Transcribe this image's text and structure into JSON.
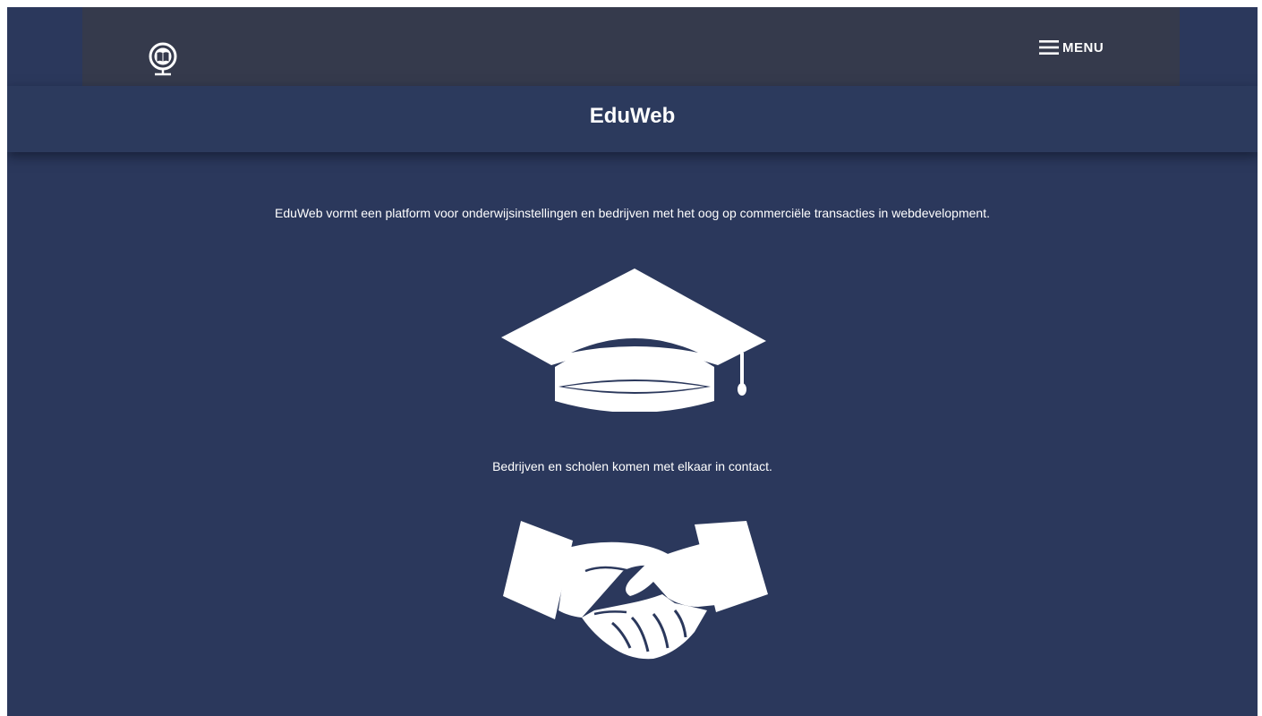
{
  "header": {
    "logo_icon": "globe-book-icon",
    "menu_icon": "hamburger-icon",
    "menu_label": "MENU",
    "title": "EduWeb"
  },
  "main": {
    "intro_text": "EduWeb vormt een platform voor onderwijsinstellingen en bedrijven met het oog op commerciële transacties in webdevelopment.",
    "illustration_1": "graduation-cap-icon",
    "caption": "Bedrijven en scholen komen met elkaar in contact.",
    "illustration_2": "handshake-icon"
  },
  "colors": {
    "background": "#2b385c",
    "topbar": "#353a4c",
    "text": "#ffffff"
  }
}
